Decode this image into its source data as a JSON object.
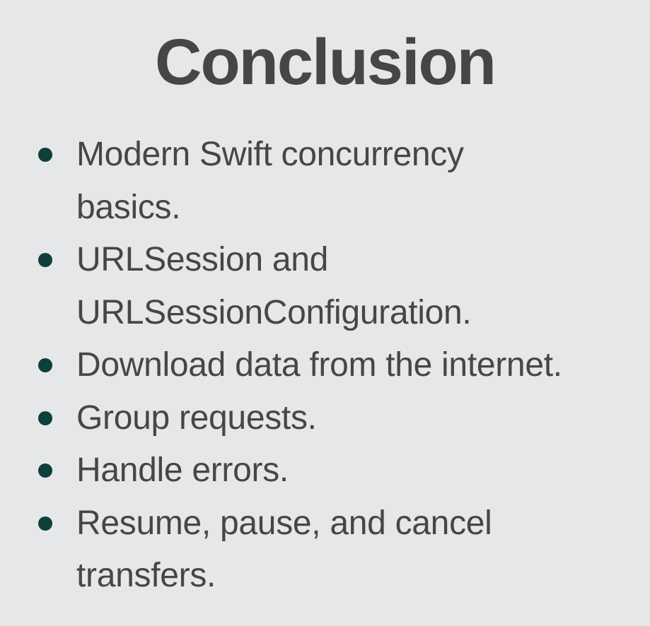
{
  "slide": {
    "title": "Conclusion",
    "bullets": [
      {
        "lines": [
          "Modern Swift concurrency",
          "basics."
        ]
      },
      {
        "lines": [
          "URLSession and",
          "URLSessionConfiguration."
        ]
      },
      {
        "lines": [
          "Download data from the internet."
        ]
      },
      {
        "lines": [
          "Group requests."
        ]
      },
      {
        "lines": [
          "Handle errors."
        ]
      },
      {
        "lines": [
          "Resume, pause, and cancel",
          "transfers."
        ]
      }
    ]
  },
  "colors": {
    "background": "#e6e7e9",
    "text": "#464646",
    "bullet": "#0f3f3a"
  }
}
